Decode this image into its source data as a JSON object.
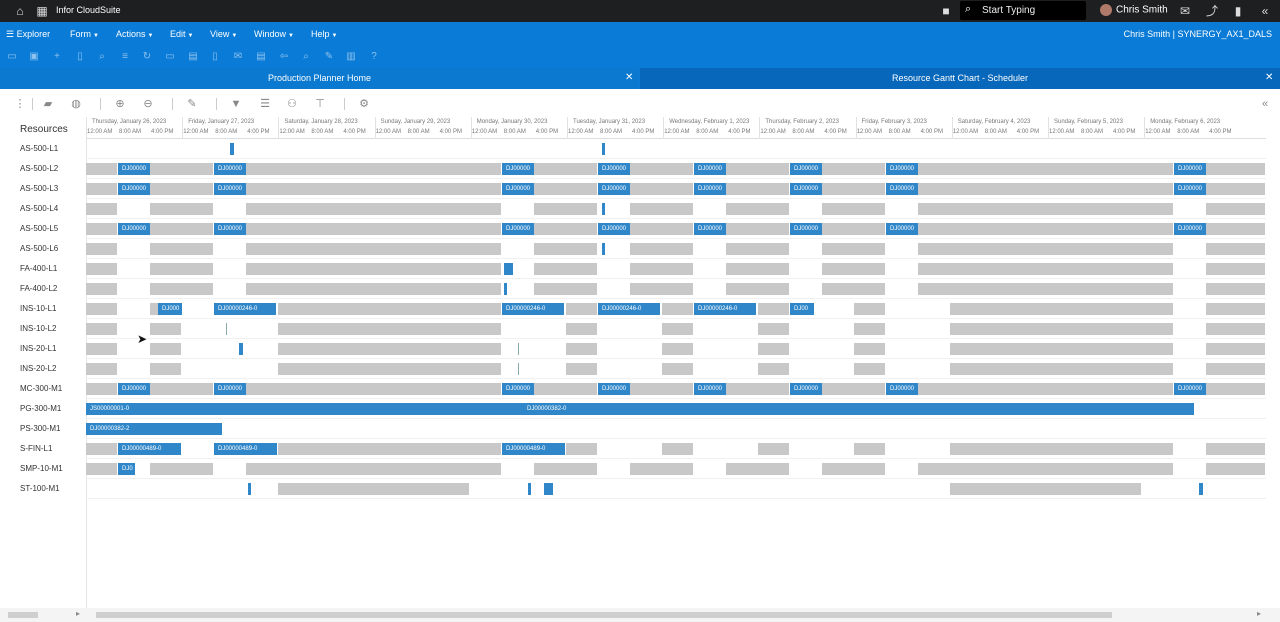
{
  "topbar": {
    "brand": "Infor CloudSuite",
    "search_placeholder": "Start Typing",
    "user_name": "Chris Smith"
  },
  "menubar": {
    "explorer": "Explorer",
    "menus": [
      "Form",
      "Actions",
      "Edit",
      "View",
      "Window",
      "Help"
    ],
    "context": "Chris Smith | SYNERGY_AX1_DALS"
  },
  "tabs": {
    "production_planner": "Production Planner Home",
    "gantt": "Resource Gantt Chart - Scheduler"
  },
  "gantt": {
    "resources_header": "Resources",
    "days": [
      "Thursday, January 26, 2023",
      "Friday, January 27, 2023",
      "Saturday, January 28, 2023",
      "Sunday, January 29, 2023",
      "Monday, January 30, 2023",
      "Tuesday, January 31, 2023",
      "Wednesday, February 1, 2023",
      "Thursday, February 2, 2023",
      "Friday, February 3, 2023",
      "Saturday, February 4, 2023",
      "Sunday, February 5, 2023",
      "Monday, February 6, 2023"
    ],
    "hours": [
      "12:00 AM",
      "8:00 AM",
      "4:00 PM"
    ],
    "rows": [
      {
        "name": "AS-500-L1",
        "jobs": []
      },
      {
        "name": "AS-500-L2",
        "jobs": [
          "DJ00000",
          "DJ00000",
          "DJ00000",
          "DJ00000",
          "DJ00000",
          "DJ00000",
          "DJ00000",
          "DJ00000"
        ]
      },
      {
        "name": "AS-500-L3",
        "jobs": [
          "DJ00000",
          "DJ00000",
          "DJ00000",
          "DJ00000",
          "DJ00000",
          "DJ00000",
          "DJ00000",
          "DJ00000"
        ]
      },
      {
        "name": "AS-500-L4",
        "jobs": []
      },
      {
        "name": "AS-500-L5",
        "jobs": [
          "DJ00000",
          "DJ00000",
          "DJ00000",
          "DJ00000",
          "DJ00000",
          "DJ00000",
          "DJ00000",
          "DJ00000"
        ]
      },
      {
        "name": "AS-500-L6",
        "jobs": []
      },
      {
        "name": "FA-400-L1",
        "jobs": []
      },
      {
        "name": "FA-400-L2",
        "jobs": []
      },
      {
        "name": "INS-10-L1",
        "jobs": [
          "DJ000",
          "DJ00000246-0",
          "DJ00000246-0",
          "DJ00000246-0",
          "DJ00000246-0",
          "DJ00"
        ]
      },
      {
        "name": "INS-10-L2",
        "jobs": []
      },
      {
        "name": "INS-20-L1",
        "jobs": []
      },
      {
        "name": "INS-20-L2",
        "jobs": []
      },
      {
        "name": "MC-300-M1",
        "jobs": [
          "DJ00000",
          "DJ00000",
          "DJ00000",
          "DJ00000",
          "DJ00000",
          "DJ00000",
          "DJ00000",
          "DJ00000"
        ]
      },
      {
        "name": "PG-300-M1",
        "jobs": [
          "JS00000001-0",
          "DJ00000382-0"
        ]
      },
      {
        "name": "PS-300-M1",
        "jobs": [
          "DJ00000382-2"
        ]
      },
      {
        "name": "S-FIN-L1",
        "jobs": [
          "DJ00000489-0",
          "DJ00000489-0",
          "DJ00000489-0"
        ]
      },
      {
        "name": "SMP-10-M1",
        "jobs": [
          "DJ0"
        ]
      },
      {
        "name": "ST-100-M1",
        "jobs": []
      }
    ]
  },
  "colors": {
    "topbar": "#1e1f21",
    "menubar": "#0a7bd6",
    "job": "#2f86c8",
    "offtime": "#c8c8c8"
  }
}
